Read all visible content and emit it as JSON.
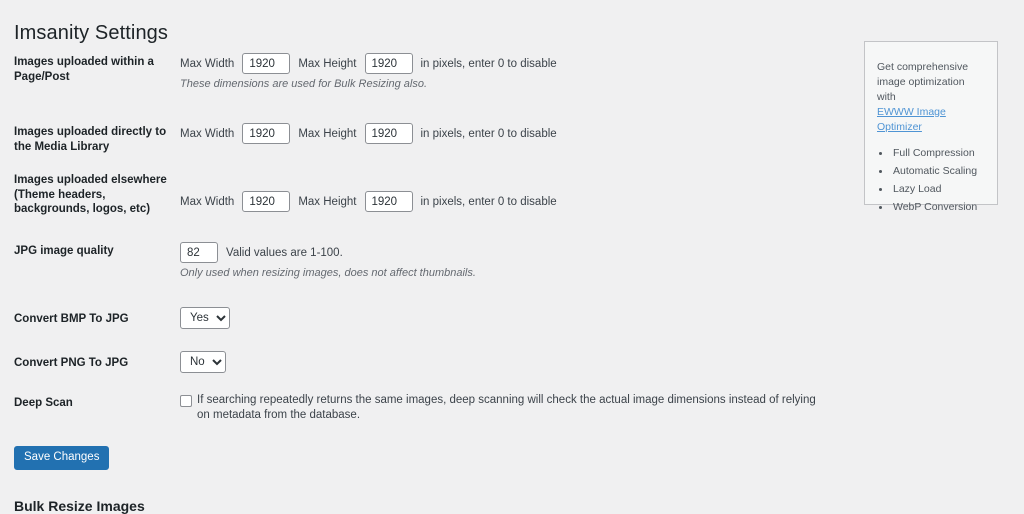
{
  "page": {
    "title": "Imsanity Settings",
    "section_heading": "Bulk Resize Images",
    "save_label": "Save Changes"
  },
  "labels": {
    "max_width": "Max Width",
    "max_height": "Max Height",
    "pixels_note": "in pixels, enter 0 to disable"
  },
  "rows": {
    "page_post": {
      "label": "Images uploaded within a Page/Post",
      "width_value": "1920",
      "height_value": "1920",
      "hint": "These dimensions are used for Bulk Resizing also."
    },
    "media_library": {
      "label": "Images uploaded directly to the Media Library",
      "width_value": "1920",
      "height_value": "1920"
    },
    "elsewhere": {
      "label": "Images uploaded elsewhere (Theme headers, backgrounds, logos, etc)",
      "width_value": "1920",
      "height_value": "1920"
    },
    "jpg_quality": {
      "label": "JPG image quality",
      "value": "82",
      "note": "Valid values are 1-100.",
      "hint": "Only used when resizing images, does not affect thumbnails."
    },
    "convert_bmp": {
      "label": "Convert BMP To JPG",
      "value": "Yes",
      "options": [
        "Yes",
        "No"
      ]
    },
    "convert_png": {
      "label": "Convert PNG To JPG",
      "value": "No",
      "options": [
        "Yes",
        "No"
      ]
    },
    "deep_scan": {
      "label": "Deep Scan",
      "checked": false,
      "description": "If searching repeatedly returns the same images, deep scanning will check the actual image dimensions instead of relying on metadata from the database."
    }
  },
  "promo": {
    "text": "Get comprehensive image optimization with",
    "link": "EWWW Image Optimizer",
    "items": [
      "Full Compression",
      "Automatic Scaling",
      "Lazy Load",
      "WebP Conversion"
    ]
  },
  "colors": {
    "background": "#f0f0f1",
    "accent": "#2271b1",
    "link": "#4f94d4",
    "heading": "#1d2327",
    "body_text": "#3c434a",
    "hint_text": "#646970",
    "border": "#8c8f94",
    "promo_bg": "#f6f7f7",
    "promo_border": "#c3c4c7"
  }
}
